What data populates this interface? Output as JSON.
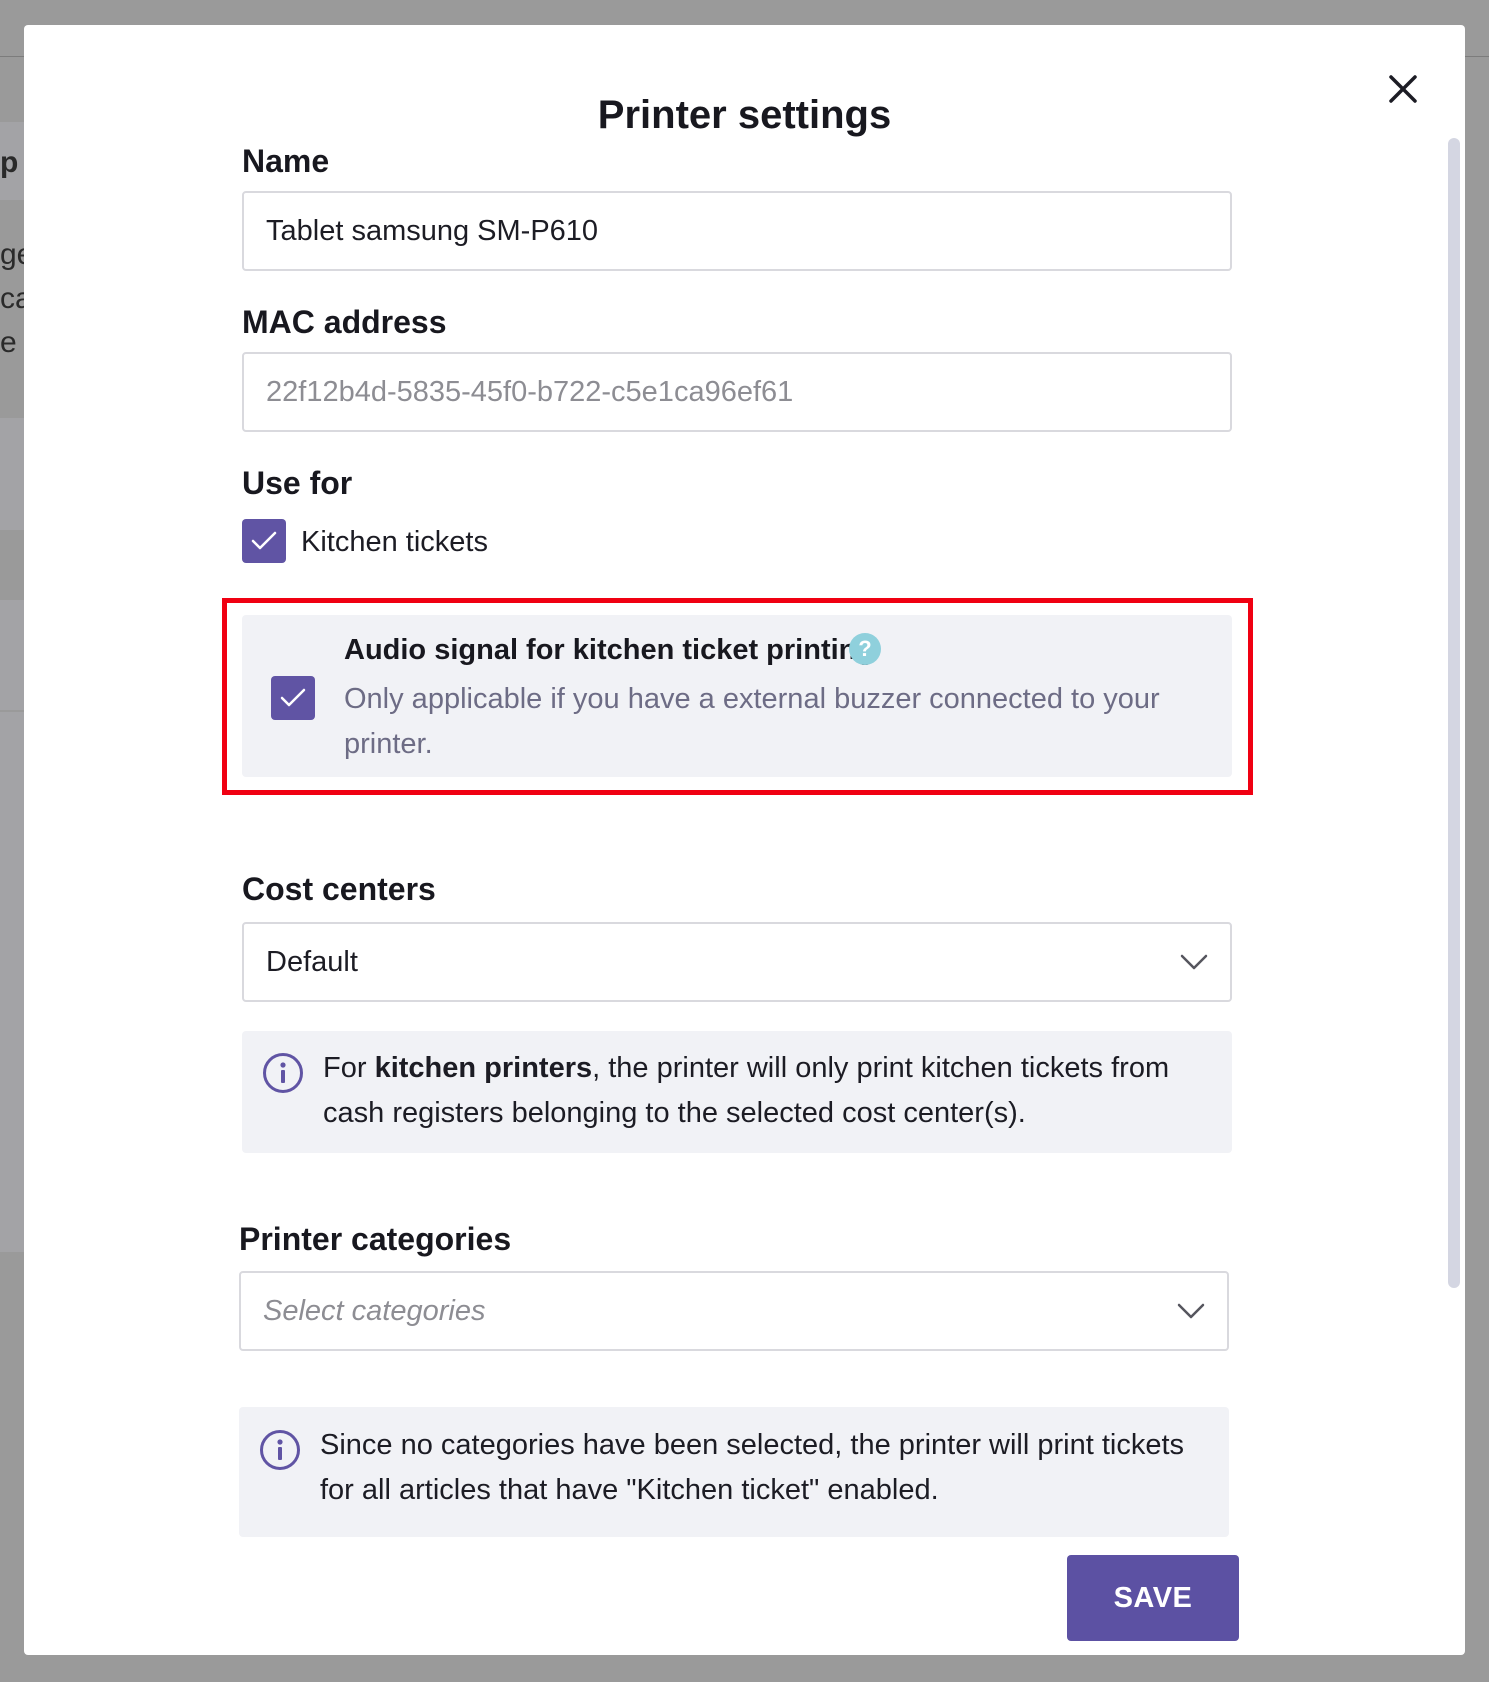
{
  "background_page": {
    "fragments": [
      "p",
      "ge",
      "ca",
      "e g"
    ]
  },
  "modal": {
    "title": "Printer settings",
    "close_icon": "close-icon"
  },
  "name_field": {
    "label": "Name",
    "value": "Tablet samsung SM-P610"
  },
  "mac_field": {
    "label": "MAC address",
    "value": "22f12b4d-5835-45f0-b722-c5e1ca96ef61"
  },
  "use_for": {
    "label": "Use for",
    "kitchen_tickets": {
      "label": "Kitchen tickets",
      "checked": true
    }
  },
  "audio_signal": {
    "title": "Audio signal for kitchen ticket printing",
    "help_icon": "?",
    "description": "Only applicable if you have a external buzzer connected to your printer.",
    "checked": true,
    "highlight_color": "#f00012"
  },
  "cost_centers": {
    "label": "Cost centers",
    "selected": "Default",
    "info_prefix": "For ",
    "info_bold": "kitchen printers",
    "info_suffix": ", the printer will only print kitchen tickets from cash registers belonging to the selected cost center(s)."
  },
  "printer_categories": {
    "label": "Printer categories",
    "placeholder": "Select categories",
    "info": "Since no categories have been selected, the printer will print tickets for all articles that have \"Kitchen ticket\" enabled."
  },
  "save_button": {
    "label": "SAVE"
  },
  "colors": {
    "accent": "#5c51a3",
    "panel_bg": "#f1f2f6",
    "help_icon_bg": "#8fd0dc"
  }
}
